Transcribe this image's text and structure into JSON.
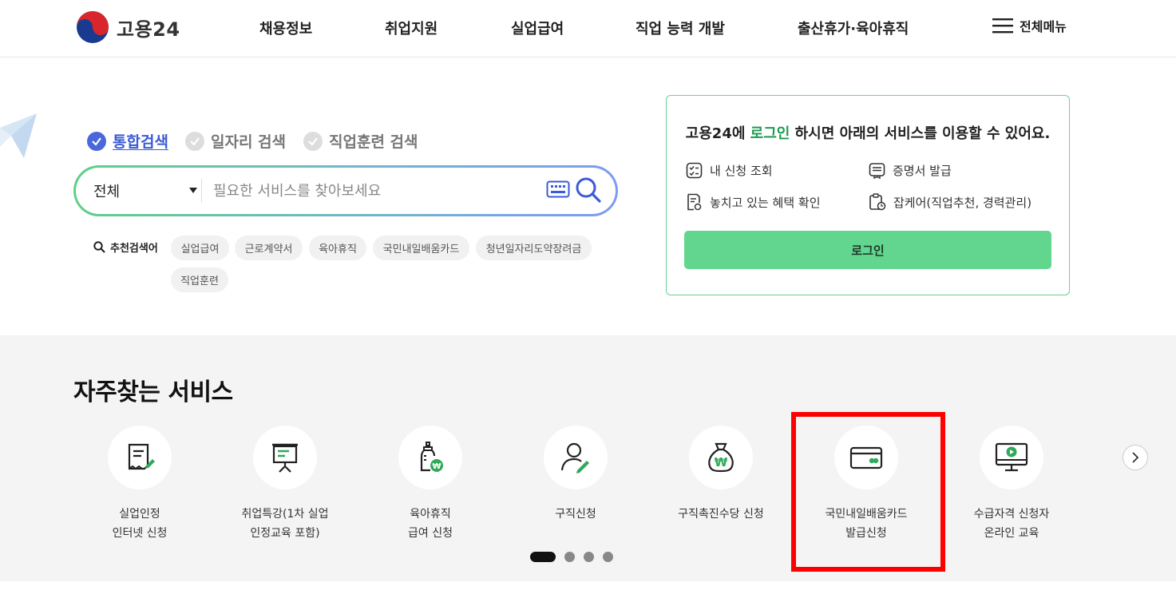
{
  "header": {
    "logo_text": "고용24",
    "nav": [
      "채용정보",
      "취업지원",
      "실업급여",
      "직업 능력 개발",
      "출산휴가·육아휴직"
    ],
    "menu_label": "전체메뉴"
  },
  "search": {
    "tabs": [
      {
        "label": "통합검색",
        "active": true
      },
      {
        "label": "일자리 검색",
        "active": false
      },
      {
        "label": "직업훈련 검색",
        "active": false
      }
    ],
    "scope": "전체",
    "placeholder": "필요한 서비스를 찾아보세요",
    "recommended_label": "추천검색어",
    "recommended": [
      "실업급여",
      "근로계약서",
      "육아휴직",
      "국민내일배움카드",
      "청년일자리도약장려금",
      "직업훈련"
    ]
  },
  "login": {
    "message_prefix": "고용24에 ",
    "message_highlight": "로그인",
    "message_suffix": " 하시면 아래의 서비스를 이용할 수 있어요.",
    "services": [
      "내 신청 조회",
      "증명서 발급",
      "놓치고 있는 혜택 확인",
      "잡케어(직업추천, 경력관리)"
    ],
    "button_label": "로그인"
  },
  "frequent": {
    "title": "자주찾는 서비스",
    "items": [
      {
        "line1": "실업인정",
        "line2": "인터넷 신청",
        "icon": "document-pen-icon"
      },
      {
        "line1": "취업특강(1차 실업",
        "line2": "인정교육 포함)",
        "icon": "presentation-board-icon"
      },
      {
        "line1": "육아휴직",
        "line2": "급여 신청",
        "icon": "baby-bottle-won-icon"
      },
      {
        "line1": "구직신청",
        "line2": "",
        "icon": "person-pen-icon"
      },
      {
        "line1": "구직촉진수당 신청",
        "line2": "",
        "icon": "money-bag-icon"
      },
      {
        "line1": "국민내일배움카드",
        "line2": "발급신청",
        "icon": "card-icon"
      },
      {
        "line1": "수급자격 신청자",
        "line2": "온라인 교육",
        "icon": "monitor-play-icon"
      }
    ],
    "page_count": 4,
    "current_page": 1
  },
  "colors": {
    "accent_green": "#62d58f",
    "tab_blue": "#4a68db",
    "highlight_red": "#ff0000"
  }
}
